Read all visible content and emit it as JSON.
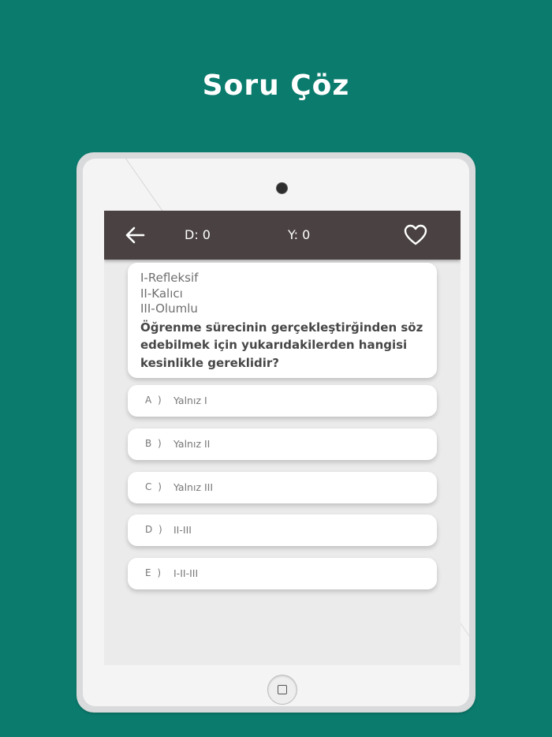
{
  "headline": "Soru Çöz",
  "appbar": {
    "correct_label": "D: 0",
    "wrong_label": "Y: 0",
    "back_icon": "arrow-left-icon",
    "favorite_icon": "heart-outline-icon"
  },
  "question": {
    "premises": [
      "I-Refleksif",
      "II-Kalıcı",
      "III-Olumlu"
    ],
    "text": "Öğrenme sürecinin gerçekleştirğinden söz edebilmek için yukarıdakilerden hangisi kesinlikle gereklidir?"
  },
  "options": [
    {
      "letter": "A )",
      "text": "Yalnız I"
    },
    {
      "letter": "B )",
      "text": "Yalnız II"
    },
    {
      "letter": "C )",
      "text": "Yalnız III"
    },
    {
      "letter": "D )",
      "text": "II-III"
    },
    {
      "letter": "E )",
      "text": "I-II-III"
    }
  ],
  "colors": {
    "background": "#0b7b6d",
    "appbar": "#4a4242",
    "card": "#ffffff"
  }
}
